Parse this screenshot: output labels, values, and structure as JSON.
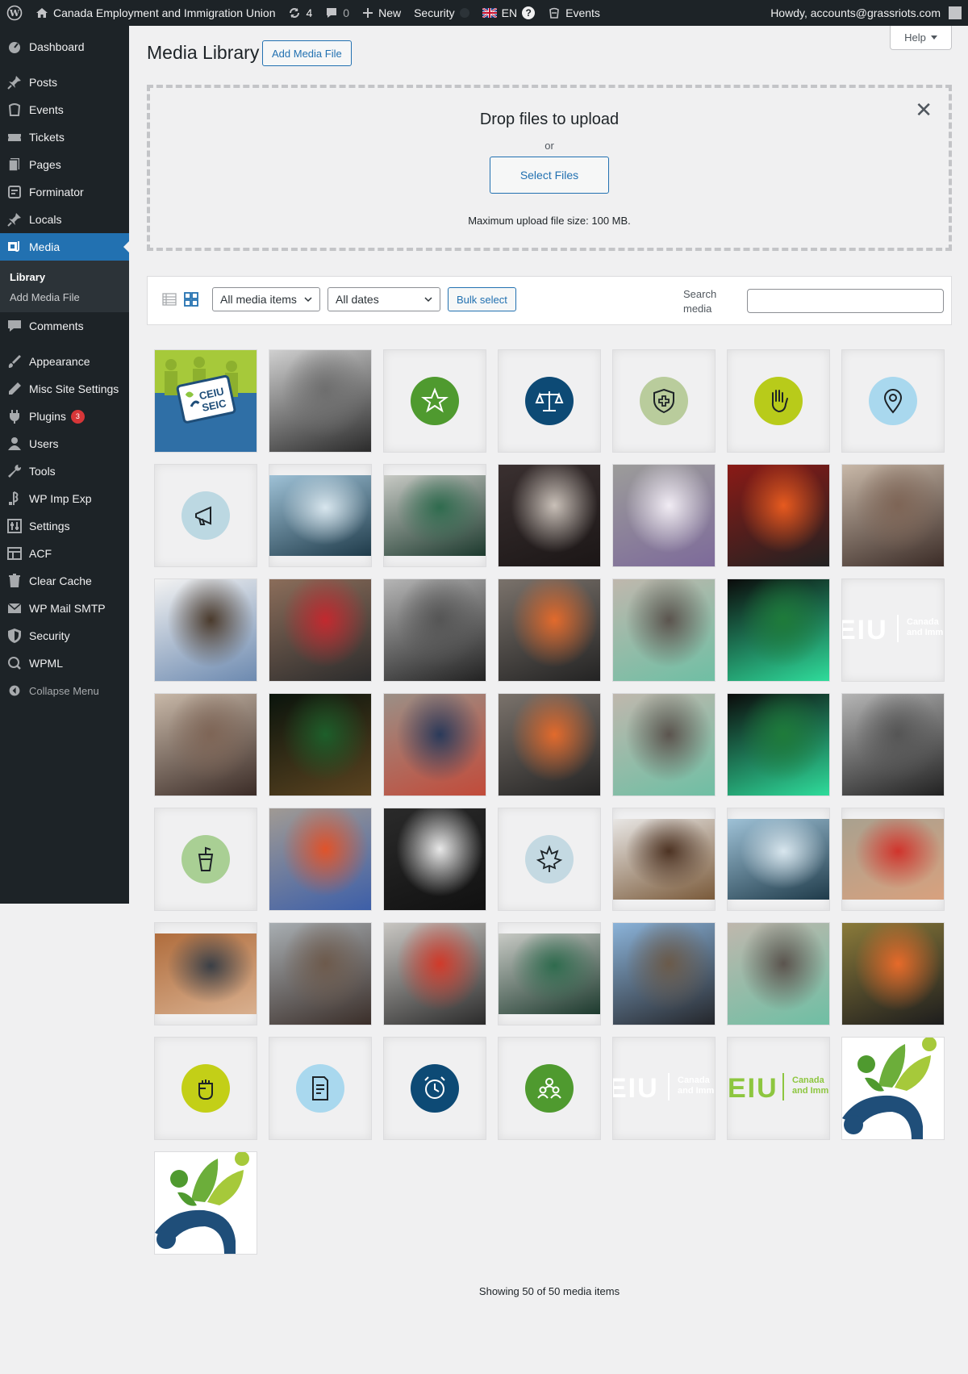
{
  "adminbar": {
    "site_name": "Canada Employment and Immigration Union",
    "updates_count": "4",
    "comments_count": "0",
    "new_label": "New",
    "security_label": "Security",
    "language_label": "EN",
    "events_label": "Events",
    "greeting": "Howdy, accounts@grassriots.com"
  },
  "sidebar": {
    "items": [
      {
        "label": "Dashboard",
        "icon": "dashboard-icon"
      },
      {
        "label": "Posts",
        "icon": "pin-icon"
      },
      {
        "label": "Events",
        "icon": "events-icon"
      },
      {
        "label": "Tickets",
        "icon": "ticket-icon"
      },
      {
        "label": "Pages",
        "icon": "pages-icon"
      },
      {
        "label": "Forminator",
        "icon": "forminator-icon"
      },
      {
        "label": "Locals",
        "icon": "pin-icon"
      },
      {
        "label": "Media",
        "icon": "media-icon"
      },
      {
        "label": "Comments",
        "icon": "comment-icon"
      },
      {
        "label": "Appearance",
        "icon": "brush-icon"
      },
      {
        "label": "Misc Site Settings",
        "icon": "pencil-icon"
      },
      {
        "label": "Plugins",
        "icon": "plugin-icon"
      },
      {
        "label": "Users",
        "icon": "users-icon"
      },
      {
        "label": "Tools",
        "icon": "wrench-icon"
      },
      {
        "label": "WP Imp Exp",
        "icon": "import-export-icon"
      },
      {
        "label": "Settings",
        "icon": "settings-icon"
      },
      {
        "label": "ACF",
        "icon": "acf-icon"
      },
      {
        "label": "Clear Cache",
        "icon": "trash-icon"
      },
      {
        "label": "WP Mail SMTP",
        "icon": "mail-icon"
      },
      {
        "label": "Security",
        "icon": "shield-icon"
      },
      {
        "label": "WPML",
        "icon": "wpml-icon"
      }
    ],
    "plugins_badge": "3",
    "submenu": {
      "library": "Library",
      "add_media_file": "Add Media File"
    },
    "collapse_label": "Collapse Menu"
  },
  "help_label": "Help",
  "page_title": "Media Library",
  "add_media_button": "Add Media File",
  "uploader": {
    "title": "Drop files to upload",
    "or": "or",
    "select_files": "Select Files",
    "max_size": "Maximum upload file size: 100 MB."
  },
  "toolbar": {
    "type_filter": "All media items",
    "date_filter": "All dates",
    "bulk_select": "Bulk select",
    "search_label": "Search media"
  },
  "media_items": [
    {
      "kind": "logo-banner",
      "alt": "CEIU SEIC"
    },
    {
      "kind": "photo",
      "tone": "bw"
    },
    {
      "kind": "icon",
      "icon": "star-icon",
      "color": "#4f9a2f"
    },
    {
      "kind": "icon",
      "icon": "scales-icon",
      "color": "#0d4a75"
    },
    {
      "kind": "icon",
      "icon": "health-shield-icon",
      "color": "#b9cc9c"
    },
    {
      "kind": "icon",
      "icon": "raised-hand-icon",
      "color": "#b8cb1a"
    },
    {
      "kind": "icon",
      "icon": "location-pin-icon",
      "color": "#a9d8ee"
    },
    {
      "kind": "icon",
      "icon": "megaphone-icon",
      "color": "#bcd8e2"
    },
    {
      "kind": "photo",
      "tone": "mountains"
    },
    {
      "kind": "photo",
      "tone": "green-coats"
    },
    {
      "kind": "photo",
      "tone": "indoor-dark"
    },
    {
      "kind": "photo",
      "tone": "banner-human"
    },
    {
      "kind": "photo",
      "tone": "flags-red"
    },
    {
      "kind": "photo",
      "tone": "building-crowd"
    },
    {
      "kind": "photo",
      "tone": "portrait-hat"
    },
    {
      "kind": "photo",
      "tone": "rally-red"
    },
    {
      "kind": "photo",
      "tone": "bw-portrait"
    },
    {
      "kind": "photo",
      "tone": "orange-hats"
    },
    {
      "kind": "photo",
      "tone": "conference"
    },
    {
      "kind": "photo",
      "tone": "podium-green"
    },
    {
      "kind": "eiu-white"
    },
    {
      "kind": "photo",
      "tone": "building-crowd"
    },
    {
      "kind": "photo",
      "tone": "speaker-green"
    },
    {
      "kind": "photo",
      "tone": "street-rally"
    },
    {
      "kind": "photo",
      "tone": "orange-hats"
    },
    {
      "kind": "photo",
      "tone": "conference"
    },
    {
      "kind": "photo",
      "tone": "podium-green"
    },
    {
      "kind": "photo",
      "tone": "bw-portrait"
    },
    {
      "kind": "icon",
      "icon": "podium-icon",
      "color": "#a9cf94"
    },
    {
      "kind": "photo",
      "tone": "protest-signs"
    },
    {
      "kind": "photo",
      "tone": "bw-sign"
    },
    {
      "kind": "icon",
      "icon": "maple-leaf-icon",
      "color": "#c4d9e2"
    },
    {
      "kind": "photo",
      "tone": "portrait-brown"
    },
    {
      "kind": "photo",
      "tone": "mountains"
    },
    {
      "kind": "photo",
      "tone": "smiling-red"
    },
    {
      "kind": "photo",
      "tone": "smiling-beanie"
    },
    {
      "kind": "photo",
      "tone": "winter-trees"
    },
    {
      "kind": "photo",
      "tone": "picket-line"
    },
    {
      "kind": "photo",
      "tone": "green-coats"
    },
    {
      "kind": "photo",
      "tone": "parliament"
    },
    {
      "kind": "photo",
      "tone": "conference"
    },
    {
      "kind": "photo",
      "tone": "two-men-flags"
    },
    {
      "kind": "icon",
      "icon": "raised-fist-icon",
      "color": "#c3cf17"
    },
    {
      "kind": "icon",
      "icon": "document-icon",
      "color": "#a9d8ee"
    },
    {
      "kind": "icon",
      "icon": "alarm-clock-icon",
      "color": "#0d4a75"
    },
    {
      "kind": "icon",
      "icon": "people-group-icon",
      "color": "#4f9a2f"
    },
    {
      "kind": "eiu-white"
    },
    {
      "kind": "eiu-green"
    },
    {
      "kind": "logo-mark"
    },
    {
      "kind": "logo-mark"
    }
  ],
  "eiu": {
    "letters": "EIU",
    "sub1": "Canada",
    "sub2": "and Imm"
  },
  "footer_count": "Showing 50 of 50 media items",
  "colors": {
    "admin_dark": "#1d2327",
    "wp_blue": "#2271b1",
    "brand_green": "#8dc63f",
    "brand_navy": "#1f4e79"
  }
}
